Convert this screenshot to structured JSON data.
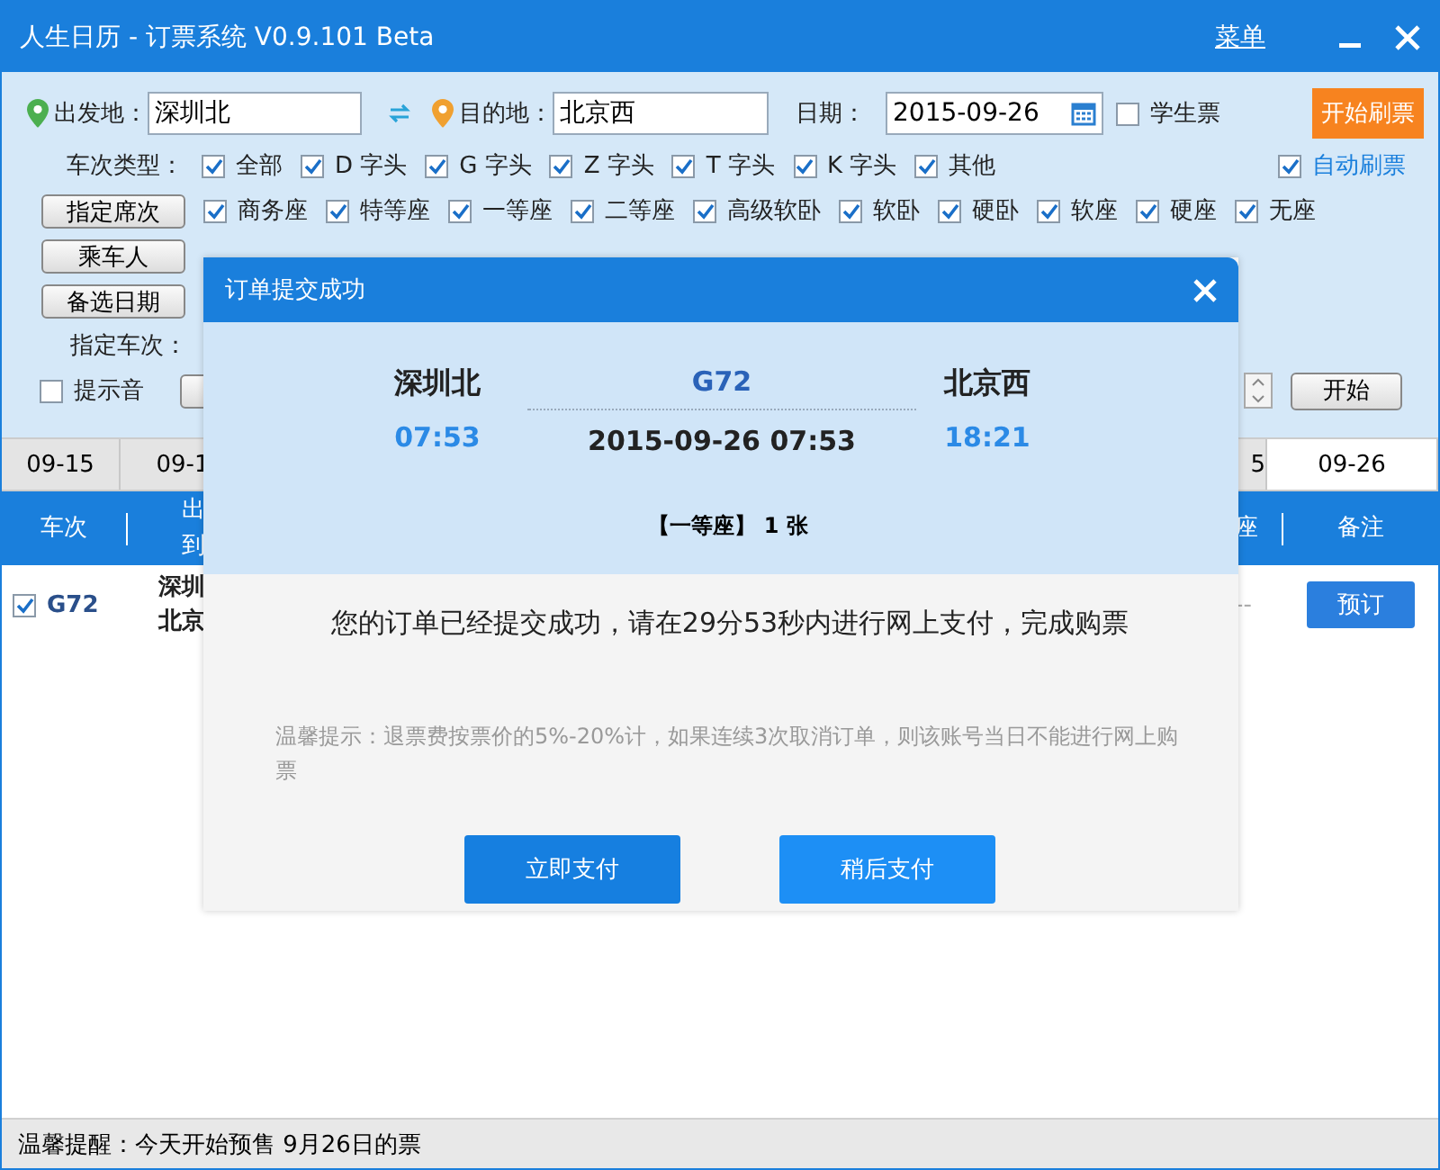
{
  "window": {
    "title": "人生日历 - 订票系统 V0.9.101 Beta",
    "menu": "菜单"
  },
  "route": {
    "from_label": "出发地：",
    "from": "深圳北",
    "to_label": "目的地：",
    "to": "北京西",
    "date_label": "日期：",
    "date": "2015-09-26",
    "student": {
      "label": "学生票",
      "checked": false
    },
    "start_button": "开始刷票"
  },
  "train_types": {
    "label": "车次类型：",
    "options": [
      {
        "label": "全部",
        "checked": true
      },
      {
        "label": "D 字头",
        "checked": true
      },
      {
        "label": "G 字头",
        "checked": true
      },
      {
        "label": "Z 字头",
        "checked": true
      },
      {
        "label": "T 字头",
        "checked": true
      },
      {
        "label": "K 字头",
        "checked": true
      },
      {
        "label": "其他",
        "checked": true
      }
    ]
  },
  "auto_refresh": {
    "label": "自动刷票",
    "checked": true
  },
  "seat_button": "指定席次",
  "seats": [
    {
      "label": "商务座",
      "checked": true
    },
    {
      "label": "特等座",
      "checked": true
    },
    {
      "label": "一等座",
      "checked": true
    },
    {
      "label": "二等座",
      "checked": true
    },
    {
      "label": "高级软卧",
      "checked": true
    },
    {
      "label": "软卧",
      "checked": true
    },
    {
      "label": "硬卧",
      "checked": true
    },
    {
      "label": "软座",
      "checked": true
    },
    {
      "label": "硬座",
      "checked": true
    },
    {
      "label": "无座",
      "checked": true
    }
  ],
  "side_buttons": [
    "乘车人",
    "备选日期"
  ],
  "train_label": "指定车次：",
  "sound": {
    "label": "提示音",
    "checked": false
  },
  "start": "开始",
  "date_tabs": [
    {
      "label": "09-15",
      "selected": false
    },
    {
      "label": "09-1",
      "selected": false
    },
    {
      "label": "5",
      "selected": false
    },
    {
      "label": "09-26",
      "selected": true
    }
  ],
  "table": {
    "columns": [
      {
        "lines": [
          "车次"
        ]
      },
      {
        "lines": [
          "出",
          "到"
        ]
      },
      {
        "lines": [
          "座"
        ]
      },
      {
        "lines": [
          "备注"
        ]
      }
    ],
    "rows": [
      {
        "checked": true,
        "train": "G72",
        "stations": [
          "深圳",
          "北京"
        ],
        "column_3": "--",
        "action": "预订"
      }
    ]
  },
  "status_bar": "温馨提醒：今天开始预售 9月26日的票",
  "dialog": {
    "title": "订单提交成功",
    "from": "深圳北",
    "depart": "07:53",
    "train": "G72",
    "datetime": "2015-09-26 07:53",
    "to": "北京西",
    "arrive": "18:21",
    "seat": "【一等座】",
    "count": "1 张",
    "message": "您的订单已经提交成功，请在29分53秒内进行网上支付，完成购票",
    "hint": "温馨提示：退票费按票价的5%-20%计，如果连续3次取消订单，则该账号当日不能进行网上购票",
    "buttons": [
      "立即支付",
      "稍后支付"
    ]
  }
}
